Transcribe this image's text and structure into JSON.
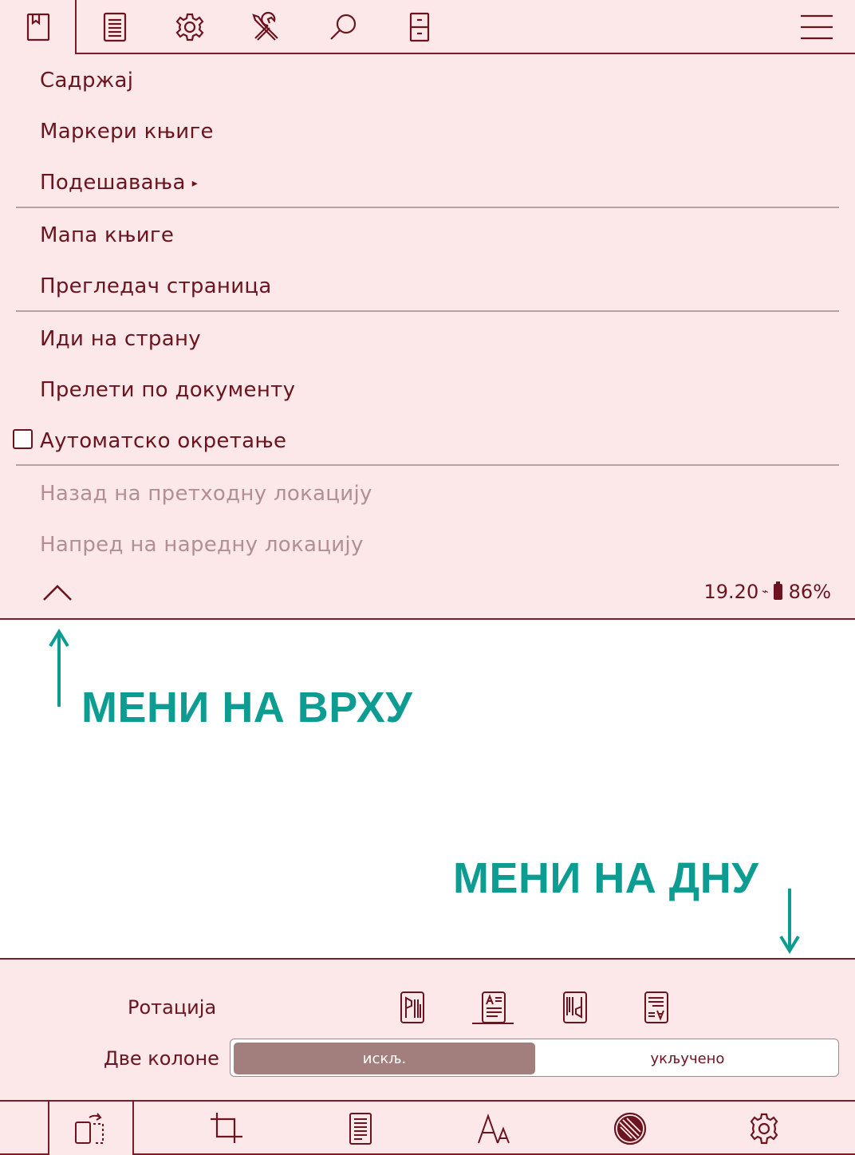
{
  "top_menu": {
    "tabs": [
      {
        "icon": "bookmark-icon"
      },
      {
        "icon": "document-icon"
      },
      {
        "icon": "gear-icon"
      },
      {
        "icon": "tools-icon"
      },
      {
        "icon": "search-icon"
      },
      {
        "icon": "cabinet-icon"
      },
      {
        "icon": "hamburger-icon"
      }
    ],
    "items": {
      "contents": "Садржај",
      "bookmarks": "Маркери књиге",
      "settings": "Подешавања",
      "book_map": "Мапа књиге",
      "page_browser": "Прегледач страница",
      "go_to_page": "Иди на страну",
      "skim_document": "Прелети по документу",
      "auto_rotate": "Аутоматско окретање",
      "back_location": "Назад на претходну локацију",
      "forward_location": "Напред на наредну локацију"
    },
    "submenu_arrow": "▸",
    "auto_rotate_checked": false,
    "status": {
      "time": "19.20",
      "charge_glyph": "⌁",
      "battery": "86%"
    }
  },
  "annotations": {
    "top": "МЕНИ НА ВРХУ",
    "bottom": "МЕНИ НА ДНУ",
    "color": "#0c9c92"
  },
  "bottom_menu": {
    "rotation_label": "Ротација",
    "rotation_options": [
      "rotate-90-icon",
      "rotate-0-icon",
      "rotate-270-icon",
      "rotate-180-icon"
    ],
    "rotation_selected": 1,
    "two_columns_label": "Две колоне",
    "two_columns_off": "искљ.",
    "two_columns_on": "укључено",
    "two_columns_selected": "off",
    "tabs": [
      {
        "icon": "rotate-screen-icon",
        "active": true
      },
      {
        "icon": "crop-icon"
      },
      {
        "icon": "page-icon"
      },
      {
        "icon": "font-size-icon"
      },
      {
        "icon": "contrast-icon"
      },
      {
        "icon": "gear-icon"
      }
    ]
  },
  "colors": {
    "menu_background": "#fce8e8",
    "accent": "#7a1d28",
    "text": "#6b1420",
    "disabled_text": "#b28f94",
    "toggle_selected": "#a27e7c"
  }
}
